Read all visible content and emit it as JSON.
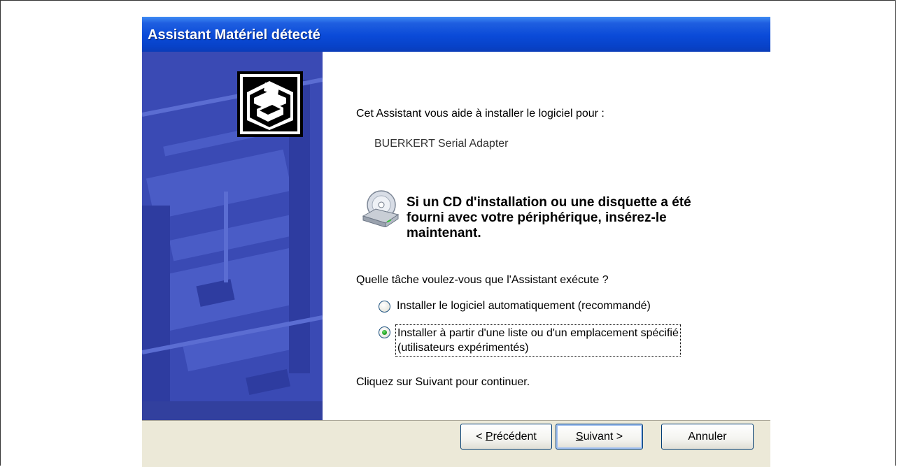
{
  "window": {
    "title": "Assistant Matériel détecté"
  },
  "content": {
    "intro": "Cet Assistant vous aide à installer le logiciel pour :",
    "device_name": "BUERKERT Serial Adapter",
    "notice": "Si un CD d'installation ou une disquette a été\nfourni avec votre périphérique, insérez-le\nmaintenant.",
    "question": "Quelle tâche voulez-vous que l'Assistant exécute ?",
    "options": [
      {
        "label": "Installer le logiciel automatiquement (recommandé)",
        "selected": false
      },
      {
        "label_line1": "Installer à partir d'une liste ou d'un emplacement spécifié",
        "label_line2": "(utilisateurs expérimentés)",
        "selected": true
      }
    ],
    "continue_hint": "Cliquez sur Suivant pour continuer."
  },
  "buttons": {
    "back_prefix": "< ",
    "back_accel": "P",
    "back_rest": "récédent",
    "next_accel": "S",
    "next_rest": "uivant >",
    "cancel": "Annuler"
  },
  "icons": {
    "wizard": "hardware-wizard-icon",
    "cd": "cd-drive-icon",
    "radio_selected_color": "#21a121"
  },
  "colors": {
    "titlebar": "#0a4ad8",
    "side_panel": "#3a4ab4",
    "footer": "#ece9d8"
  }
}
